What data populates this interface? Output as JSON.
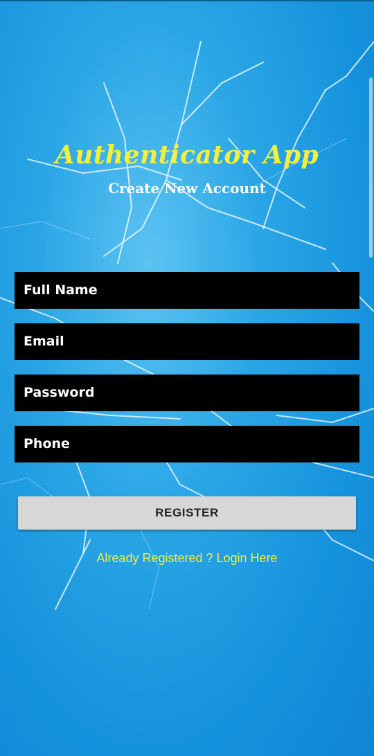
{
  "app": {
    "title": "Authenticator App",
    "subtitle": "Create New Account"
  },
  "form": {
    "fields": [
      {
        "label": "Full Name"
      },
      {
        "label": "Email"
      },
      {
        "label": "Password"
      },
      {
        "label": "Phone"
      }
    ],
    "register_label": "REGISTER",
    "login_link": "Already Registered ? Login Here"
  },
  "colors": {
    "background": "#1a9be0",
    "title": "#f5ef3a",
    "field_bg": "#000000",
    "button_bg": "#d6d7d7",
    "link": "#f2ee3c"
  }
}
